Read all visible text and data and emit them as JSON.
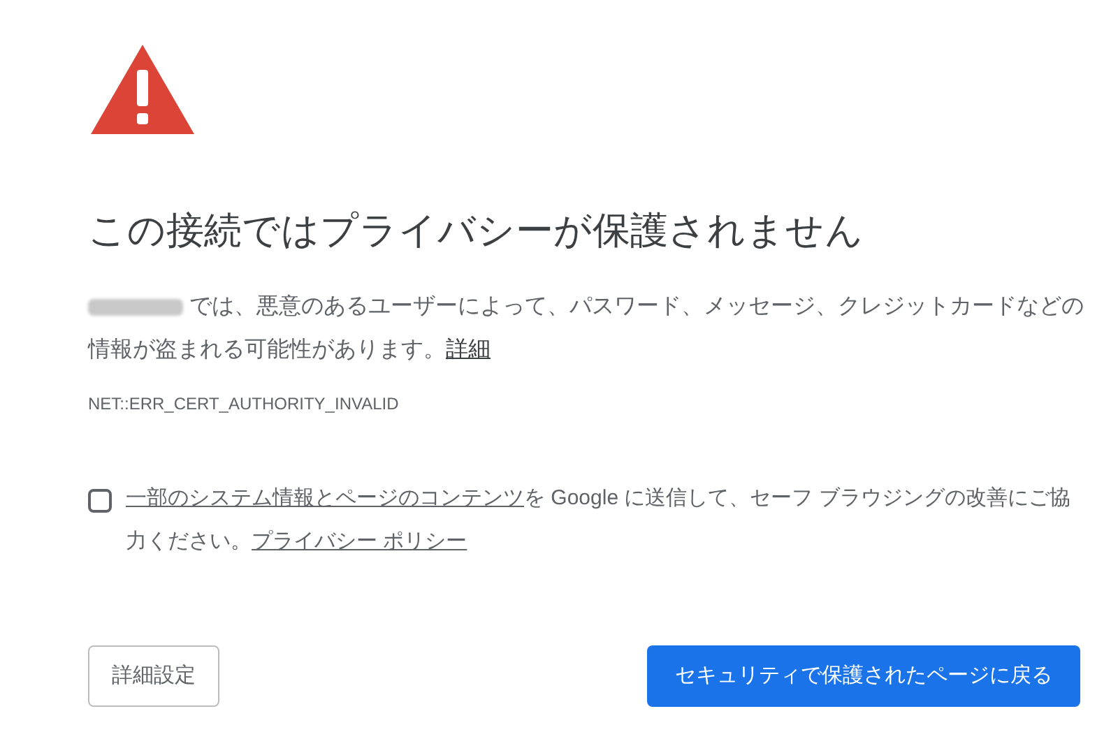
{
  "title": "この接続ではプライバシーが保護されません",
  "message": {
    "text": " では、悪意のあるユーザーによって、パスワード、メッセージ、クレジットカードなどの情報が盗まれる可能性があります。",
    "link": "詳細"
  },
  "error_code": "NET::ERR_CERT_AUTHORITY_INVALID",
  "opt_in": {
    "checked": false,
    "link": "一部のシステム情報とページのコンテンツ",
    "text": "を Google に送信して、セーフ ブラウジングの改善にご協力ください。",
    "policy_link": "プライバシー ポリシー"
  },
  "buttons": [
    {
      "kind": "secondary",
      "label": "詳細設定"
    },
    {
      "kind": "primary",
      "label": "セキュリティで保護されたページに戻る"
    }
  ]
}
